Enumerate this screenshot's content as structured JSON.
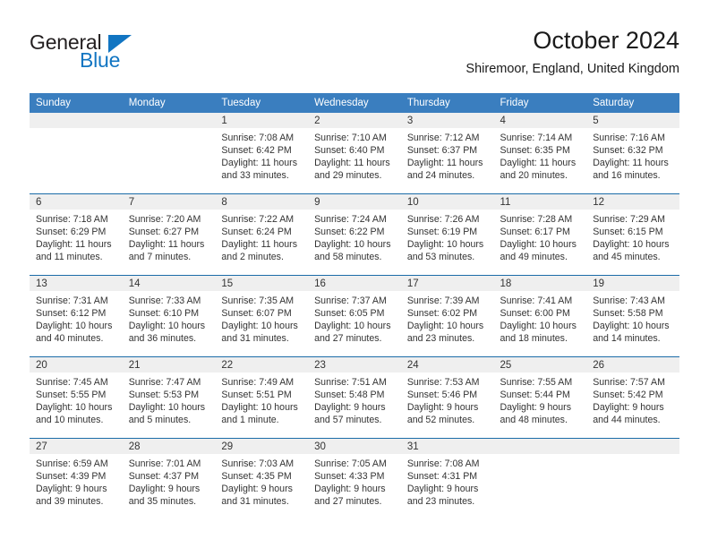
{
  "logo": {
    "word_top": "General",
    "word_bottom": "Blue",
    "accent_color": "#1175c2",
    "text_color": "#231f20"
  },
  "header": {
    "title": "October 2024",
    "subtitle": "Shiremoor, England, United Kingdom"
  },
  "theme": {
    "header_bg": "#3a7ebf",
    "row_divider": "#1b6ca8",
    "daynum_bg": "#efefef"
  },
  "weekday_headers": [
    "Sunday",
    "Monday",
    "Tuesday",
    "Wednesday",
    "Thursday",
    "Friday",
    "Saturday"
  ],
  "weeks": [
    [
      {
        "day": "",
        "sunrise": "",
        "sunset": "",
        "daylight_line1": "",
        "daylight_line2": ""
      },
      {
        "day": "",
        "sunrise": "",
        "sunset": "",
        "daylight_line1": "",
        "daylight_line2": ""
      },
      {
        "day": "1",
        "sunrise": "Sunrise: 7:08 AM",
        "sunset": "Sunset: 6:42 PM",
        "daylight_line1": "Daylight: 11 hours",
        "daylight_line2": "and 33 minutes."
      },
      {
        "day": "2",
        "sunrise": "Sunrise: 7:10 AM",
        "sunset": "Sunset: 6:40 PM",
        "daylight_line1": "Daylight: 11 hours",
        "daylight_line2": "and 29 minutes."
      },
      {
        "day": "3",
        "sunrise": "Sunrise: 7:12 AM",
        "sunset": "Sunset: 6:37 PM",
        "daylight_line1": "Daylight: 11 hours",
        "daylight_line2": "and 24 minutes."
      },
      {
        "day": "4",
        "sunrise": "Sunrise: 7:14 AM",
        "sunset": "Sunset: 6:35 PM",
        "daylight_line1": "Daylight: 11 hours",
        "daylight_line2": "and 20 minutes."
      },
      {
        "day": "5",
        "sunrise": "Sunrise: 7:16 AM",
        "sunset": "Sunset: 6:32 PM",
        "daylight_line1": "Daylight: 11 hours",
        "daylight_line2": "and 16 minutes."
      }
    ],
    [
      {
        "day": "6",
        "sunrise": "Sunrise: 7:18 AM",
        "sunset": "Sunset: 6:29 PM",
        "daylight_line1": "Daylight: 11 hours",
        "daylight_line2": "and 11 minutes."
      },
      {
        "day": "7",
        "sunrise": "Sunrise: 7:20 AM",
        "sunset": "Sunset: 6:27 PM",
        "daylight_line1": "Daylight: 11 hours",
        "daylight_line2": "and 7 minutes."
      },
      {
        "day": "8",
        "sunrise": "Sunrise: 7:22 AM",
        "sunset": "Sunset: 6:24 PM",
        "daylight_line1": "Daylight: 11 hours",
        "daylight_line2": "and 2 minutes."
      },
      {
        "day": "9",
        "sunrise": "Sunrise: 7:24 AM",
        "sunset": "Sunset: 6:22 PM",
        "daylight_line1": "Daylight: 10 hours",
        "daylight_line2": "and 58 minutes."
      },
      {
        "day": "10",
        "sunrise": "Sunrise: 7:26 AM",
        "sunset": "Sunset: 6:19 PM",
        "daylight_line1": "Daylight: 10 hours",
        "daylight_line2": "and 53 minutes."
      },
      {
        "day": "11",
        "sunrise": "Sunrise: 7:28 AM",
        "sunset": "Sunset: 6:17 PM",
        "daylight_line1": "Daylight: 10 hours",
        "daylight_line2": "and 49 minutes."
      },
      {
        "day": "12",
        "sunrise": "Sunrise: 7:29 AM",
        "sunset": "Sunset: 6:15 PM",
        "daylight_line1": "Daylight: 10 hours",
        "daylight_line2": "and 45 minutes."
      }
    ],
    [
      {
        "day": "13",
        "sunrise": "Sunrise: 7:31 AM",
        "sunset": "Sunset: 6:12 PM",
        "daylight_line1": "Daylight: 10 hours",
        "daylight_line2": "and 40 minutes."
      },
      {
        "day": "14",
        "sunrise": "Sunrise: 7:33 AM",
        "sunset": "Sunset: 6:10 PM",
        "daylight_line1": "Daylight: 10 hours",
        "daylight_line2": "and 36 minutes."
      },
      {
        "day": "15",
        "sunrise": "Sunrise: 7:35 AM",
        "sunset": "Sunset: 6:07 PM",
        "daylight_line1": "Daylight: 10 hours",
        "daylight_line2": "and 31 minutes."
      },
      {
        "day": "16",
        "sunrise": "Sunrise: 7:37 AM",
        "sunset": "Sunset: 6:05 PM",
        "daylight_line1": "Daylight: 10 hours",
        "daylight_line2": "and 27 minutes."
      },
      {
        "day": "17",
        "sunrise": "Sunrise: 7:39 AM",
        "sunset": "Sunset: 6:02 PM",
        "daylight_line1": "Daylight: 10 hours",
        "daylight_line2": "and 23 minutes."
      },
      {
        "day": "18",
        "sunrise": "Sunrise: 7:41 AM",
        "sunset": "Sunset: 6:00 PM",
        "daylight_line1": "Daylight: 10 hours",
        "daylight_line2": "and 18 minutes."
      },
      {
        "day": "19",
        "sunrise": "Sunrise: 7:43 AM",
        "sunset": "Sunset: 5:58 PM",
        "daylight_line1": "Daylight: 10 hours",
        "daylight_line2": "and 14 minutes."
      }
    ],
    [
      {
        "day": "20",
        "sunrise": "Sunrise: 7:45 AM",
        "sunset": "Sunset: 5:55 PM",
        "daylight_line1": "Daylight: 10 hours",
        "daylight_line2": "and 10 minutes."
      },
      {
        "day": "21",
        "sunrise": "Sunrise: 7:47 AM",
        "sunset": "Sunset: 5:53 PM",
        "daylight_line1": "Daylight: 10 hours",
        "daylight_line2": "and 5 minutes."
      },
      {
        "day": "22",
        "sunrise": "Sunrise: 7:49 AM",
        "sunset": "Sunset: 5:51 PM",
        "daylight_line1": "Daylight: 10 hours",
        "daylight_line2": "and 1 minute."
      },
      {
        "day": "23",
        "sunrise": "Sunrise: 7:51 AM",
        "sunset": "Sunset: 5:48 PM",
        "daylight_line1": "Daylight: 9 hours",
        "daylight_line2": "and 57 minutes."
      },
      {
        "day": "24",
        "sunrise": "Sunrise: 7:53 AM",
        "sunset": "Sunset: 5:46 PM",
        "daylight_line1": "Daylight: 9 hours",
        "daylight_line2": "and 52 minutes."
      },
      {
        "day": "25",
        "sunrise": "Sunrise: 7:55 AM",
        "sunset": "Sunset: 5:44 PM",
        "daylight_line1": "Daylight: 9 hours",
        "daylight_line2": "and 48 minutes."
      },
      {
        "day": "26",
        "sunrise": "Sunrise: 7:57 AM",
        "sunset": "Sunset: 5:42 PM",
        "daylight_line1": "Daylight: 9 hours",
        "daylight_line2": "and 44 minutes."
      }
    ],
    [
      {
        "day": "27",
        "sunrise": "Sunrise: 6:59 AM",
        "sunset": "Sunset: 4:39 PM",
        "daylight_line1": "Daylight: 9 hours",
        "daylight_line2": "and 39 minutes."
      },
      {
        "day": "28",
        "sunrise": "Sunrise: 7:01 AM",
        "sunset": "Sunset: 4:37 PM",
        "daylight_line1": "Daylight: 9 hours",
        "daylight_line2": "and 35 minutes."
      },
      {
        "day": "29",
        "sunrise": "Sunrise: 7:03 AM",
        "sunset": "Sunset: 4:35 PM",
        "daylight_line1": "Daylight: 9 hours",
        "daylight_line2": "and 31 minutes."
      },
      {
        "day": "30",
        "sunrise": "Sunrise: 7:05 AM",
        "sunset": "Sunset: 4:33 PM",
        "daylight_line1": "Daylight: 9 hours",
        "daylight_line2": "and 27 minutes."
      },
      {
        "day": "31",
        "sunrise": "Sunrise: 7:08 AM",
        "sunset": "Sunset: 4:31 PM",
        "daylight_line1": "Daylight: 9 hours",
        "daylight_line2": "and 23 minutes."
      },
      {
        "day": "",
        "sunrise": "",
        "sunset": "",
        "daylight_line1": "",
        "daylight_line2": ""
      },
      {
        "day": "",
        "sunrise": "",
        "sunset": "",
        "daylight_line1": "",
        "daylight_line2": ""
      }
    ]
  ]
}
